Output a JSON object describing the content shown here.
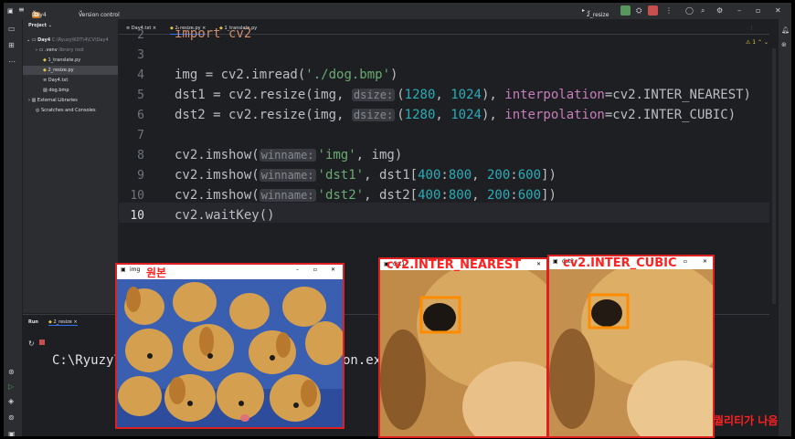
{
  "titlebar": {
    "project_badge": "D",
    "project_name": "Day4",
    "vcs_label": "Version control",
    "run_config": "2_resize"
  },
  "project_panel": {
    "title": "Project",
    "root": "Day4",
    "root_path": "C:\\Ryuzy\\KDT\\4\\CV\\Day4",
    "items": [
      {
        "label": ".venv",
        "note": "library root"
      },
      {
        "label": "1_translate.py"
      },
      {
        "label": "2_resize.py"
      },
      {
        "label": "Day4.txt"
      },
      {
        "label": "dog.bmp"
      },
      {
        "label": "External Libraries"
      },
      {
        "label": "Scratches and Consoles"
      }
    ]
  },
  "tabs": [
    {
      "label": "Day4.txt"
    },
    {
      "label": "2_resize.py"
    },
    {
      "label": "1_translate.py"
    }
  ],
  "editor": {
    "warnings": "1",
    "line_numbers": [
      "2",
      "3",
      "4",
      "5",
      "6",
      "7",
      "8",
      "9",
      "10"
    ],
    "line1_partial": "import cv2",
    "lines": {
      "l3_a": "img = cv2.imread(",
      "l3_str": "'./dog.bmp'",
      "l3_b": ")",
      "l4_a": "dst1 = cv2.resize(img, ",
      "hint_dsize": "dsize:",
      "l4_b": "(",
      "n1280": "1280",
      "comma": ", ",
      "n1024": "1024",
      "l4_c": "), ",
      "kw_interp": "interpolation",
      "l4_d": "=cv2.INTER_NEAREST)",
      "l5_a": "dst2 = cv2.resize(img, ",
      "l5_d": "=cv2.INTER_CUBIC)",
      "imshow": "cv2.imshow(",
      "hint_winname": "winname:",
      "s_img": "'img'",
      "l7_b": ", img)",
      "s_dst1": "'dst1'",
      "l8_b": ", dst1[",
      "n400": "400",
      "colon": ":",
      "n800": "800",
      "n200": "200",
      "n600": "600",
      "close": "])",
      "s_dst2": "'dst2'",
      "l9_b": ", dst2[",
      "l10": "cv2.waitKey()"
    }
  },
  "run_panel": {
    "tab_label": "Run",
    "config": "2_resize",
    "console_text": "C:\\Ryuzy\\",
    "console_tail": "on.exe"
  },
  "windows": [
    {
      "title": "img",
      "annotation": "원본"
    },
    {
      "title": "dst1",
      "annotation": "cv2.INTER_NEAREST"
    },
    {
      "title": "dst2",
      "annotation": "cv2.INTER_CUBIC"
    }
  ],
  "footer_annotation": "퀄리티가 나음",
  "colors": {
    "annotation": "#ff2020",
    "highlight_box": "#ff8c00"
  }
}
